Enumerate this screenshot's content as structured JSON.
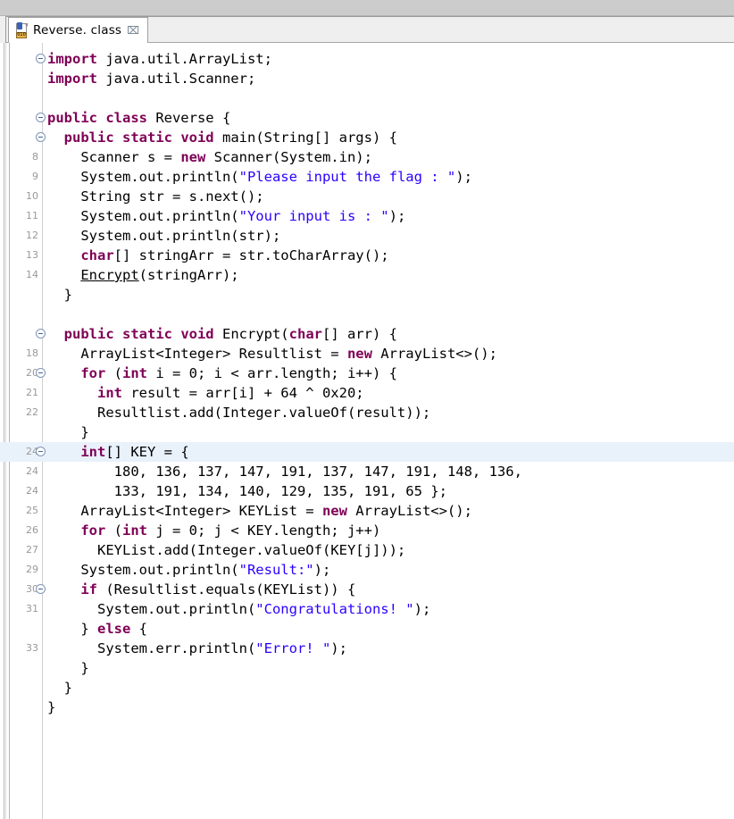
{
  "window": {
    "toolbar_present": true
  },
  "tab": {
    "icon": "java-class-file-icon",
    "icon_bits": "010",
    "label": "Reverse. class",
    "close_glyph": "⌧",
    "active": true
  },
  "colors": {
    "keyword": "#7f0055",
    "string": "#2a00ff",
    "plain": "#000000",
    "line_number": "#999999",
    "current_line_highlight": "#e9f1fb",
    "toolbar_bg": "#cccccc",
    "tab_bar_bg": "#efefef",
    "editor_bg": "#ffffff"
  },
  "editor": {
    "language": "java",
    "file_name": "Reverse.class",
    "key_array": [
      180,
      136,
      137,
      147,
      191,
      137,
      147,
      191,
      148,
      136,
      133,
      191,
      134,
      140,
      129,
      135,
      191,
      65
    ],
    "lines": [
      {
        "num": "",
        "fold": true,
        "current": false,
        "tokens": [
          {
            "t": "kw",
            "v": "import"
          },
          {
            "t": "p",
            "v": " java.util.ArrayList;"
          }
        ]
      },
      {
        "num": "",
        "fold": false,
        "current": false,
        "tokens": [
          {
            "t": "kw",
            "v": "import"
          },
          {
            "t": "p",
            "v": " java.util.Scanner;"
          }
        ]
      },
      {
        "num": "",
        "fold": false,
        "current": false,
        "tokens": [
          {
            "t": "p",
            "v": ""
          }
        ]
      },
      {
        "num": "",
        "fold": true,
        "current": false,
        "tokens": [
          {
            "t": "kw",
            "v": "public class"
          },
          {
            "t": "p",
            "v": " Reverse {"
          }
        ]
      },
      {
        "num": "",
        "fold": true,
        "current": false,
        "tokens": [
          {
            "t": "p",
            "v": "  "
          },
          {
            "t": "kw",
            "v": "public static void"
          },
          {
            "t": "p",
            "v": " main(String[] args) {"
          }
        ]
      },
      {
        "num": "8",
        "fold": false,
        "current": false,
        "tokens": [
          {
            "t": "p",
            "v": "    Scanner s = "
          },
          {
            "t": "kw",
            "v": "new"
          },
          {
            "t": "p",
            "v": " Scanner(System.in);"
          }
        ]
      },
      {
        "num": "9",
        "fold": false,
        "current": false,
        "tokens": [
          {
            "t": "p",
            "v": "    System.out.println("
          },
          {
            "t": "str",
            "v": "\"Please input the flag : \""
          },
          {
            "t": "p",
            "v": ");"
          }
        ]
      },
      {
        "num": "10",
        "fold": false,
        "current": false,
        "tokens": [
          {
            "t": "p",
            "v": "    String str = s.next();"
          }
        ]
      },
      {
        "num": "11",
        "fold": false,
        "current": false,
        "tokens": [
          {
            "t": "p",
            "v": "    System.out.println("
          },
          {
            "t": "str",
            "v": "\"Your input is : \""
          },
          {
            "t": "p",
            "v": ");"
          }
        ]
      },
      {
        "num": "12",
        "fold": false,
        "current": false,
        "tokens": [
          {
            "t": "p",
            "v": "    System.out.println(str);"
          }
        ]
      },
      {
        "num": "13",
        "fold": false,
        "current": false,
        "tokens": [
          {
            "t": "p",
            "v": "    "
          },
          {
            "t": "kw",
            "v": "char"
          },
          {
            "t": "p",
            "v": "[] stringArr = str.toCharArray();"
          }
        ]
      },
      {
        "num": "14",
        "fold": false,
        "current": false,
        "tokens": [
          {
            "t": "p",
            "v": "    "
          },
          {
            "t": "mth",
            "v": "Encrypt"
          },
          {
            "t": "p",
            "v": "(stringArr);"
          }
        ]
      },
      {
        "num": "",
        "fold": false,
        "current": false,
        "tokens": [
          {
            "t": "p",
            "v": "  }"
          }
        ]
      },
      {
        "num": "",
        "fold": false,
        "current": false,
        "tokens": [
          {
            "t": "p",
            "v": ""
          }
        ]
      },
      {
        "num": "",
        "fold": true,
        "current": false,
        "tokens": [
          {
            "t": "p",
            "v": "  "
          },
          {
            "t": "kw",
            "v": "public static void"
          },
          {
            "t": "p",
            "v": " Encrypt("
          },
          {
            "t": "kw",
            "v": "char"
          },
          {
            "t": "p",
            "v": "[] arr) {"
          }
        ]
      },
      {
        "num": "18",
        "fold": false,
        "current": false,
        "tokens": [
          {
            "t": "p",
            "v": "    ArrayList<Integer> Resultlist = "
          },
          {
            "t": "kw",
            "v": "new"
          },
          {
            "t": "p",
            "v": " ArrayList<>();"
          }
        ]
      },
      {
        "num": "20",
        "fold": true,
        "current": false,
        "tokens": [
          {
            "t": "p",
            "v": "    "
          },
          {
            "t": "kw",
            "v": "for"
          },
          {
            "t": "p",
            "v": " ("
          },
          {
            "t": "kw",
            "v": "int"
          },
          {
            "t": "p",
            "v": " i = 0; i < arr.length; i++) {"
          }
        ]
      },
      {
        "num": "21",
        "fold": false,
        "current": false,
        "tokens": [
          {
            "t": "p",
            "v": "      "
          },
          {
            "t": "kw",
            "v": "int"
          },
          {
            "t": "p",
            "v": " result = arr[i] + 64 ^ 0x20;"
          }
        ]
      },
      {
        "num": "22",
        "fold": false,
        "current": false,
        "tokens": [
          {
            "t": "p",
            "v": "      Resultlist.add(Integer.valueOf(result));"
          }
        ]
      },
      {
        "num": "",
        "fold": false,
        "current": false,
        "tokens": [
          {
            "t": "p",
            "v": "    }"
          }
        ]
      },
      {
        "num": "24",
        "fold": true,
        "current": true,
        "tokens": [
          {
            "t": "p",
            "v": "    "
          },
          {
            "t": "kw",
            "v": "int"
          },
          {
            "t": "p",
            "v": "[] KEY = {"
          }
        ]
      },
      {
        "num": "24",
        "fold": false,
        "current": false,
        "tokens": [
          {
            "t": "p",
            "v": "        180, 136, 137, 147, 191, 137, 147, 191, 148, 136,"
          }
        ]
      },
      {
        "num": "24",
        "fold": false,
        "current": false,
        "tokens": [
          {
            "t": "p",
            "v": "        133, 191, 134, 140, 129, 135, 191, 65 };"
          }
        ]
      },
      {
        "num": "25",
        "fold": false,
        "current": false,
        "tokens": [
          {
            "t": "p",
            "v": "    ArrayList<Integer> KEYList = "
          },
          {
            "t": "kw",
            "v": "new"
          },
          {
            "t": "p",
            "v": " ArrayList<>();"
          }
        ]
      },
      {
        "num": "26",
        "fold": false,
        "current": false,
        "tokens": [
          {
            "t": "p",
            "v": "    "
          },
          {
            "t": "kw",
            "v": "for"
          },
          {
            "t": "p",
            "v": " ("
          },
          {
            "t": "kw",
            "v": "int"
          },
          {
            "t": "p",
            "v": " j = 0; j < KEY.length; j++)"
          }
        ]
      },
      {
        "num": "27",
        "fold": false,
        "current": false,
        "tokens": [
          {
            "t": "p",
            "v": "      KEYList.add(Integer.valueOf(KEY[j]));"
          }
        ]
      },
      {
        "num": "29",
        "fold": false,
        "current": false,
        "tokens": [
          {
            "t": "p",
            "v": "    System.out.println("
          },
          {
            "t": "str",
            "v": "\"Result:\""
          },
          {
            "t": "p",
            "v": ");"
          }
        ]
      },
      {
        "num": "30",
        "fold": true,
        "current": false,
        "tokens": [
          {
            "t": "p",
            "v": "    "
          },
          {
            "t": "kw",
            "v": "if"
          },
          {
            "t": "p",
            "v": " (Resultlist.equals(KEYList)) {"
          }
        ]
      },
      {
        "num": "31",
        "fold": false,
        "current": false,
        "tokens": [
          {
            "t": "p",
            "v": "      System.out.println("
          },
          {
            "t": "str",
            "v": "\"Congratulations! \""
          },
          {
            "t": "p",
            "v": ");"
          }
        ]
      },
      {
        "num": "",
        "fold": false,
        "current": false,
        "tokens": [
          {
            "t": "p",
            "v": "    } "
          },
          {
            "t": "kw",
            "v": "else"
          },
          {
            "t": "p",
            "v": " {"
          }
        ]
      },
      {
        "num": "33",
        "fold": false,
        "current": false,
        "tokens": [
          {
            "t": "p",
            "v": "      System.err.println("
          },
          {
            "t": "str",
            "v": "\"Error! \""
          },
          {
            "t": "p",
            "v": ");"
          }
        ]
      },
      {
        "num": "",
        "fold": false,
        "current": false,
        "tokens": [
          {
            "t": "p",
            "v": "    }"
          }
        ]
      },
      {
        "num": "",
        "fold": false,
        "current": false,
        "tokens": [
          {
            "t": "p",
            "v": "  }"
          }
        ]
      },
      {
        "num": "",
        "fold": false,
        "current": false,
        "tokens": [
          {
            "t": "p",
            "v": "}"
          }
        ]
      }
    ]
  }
}
